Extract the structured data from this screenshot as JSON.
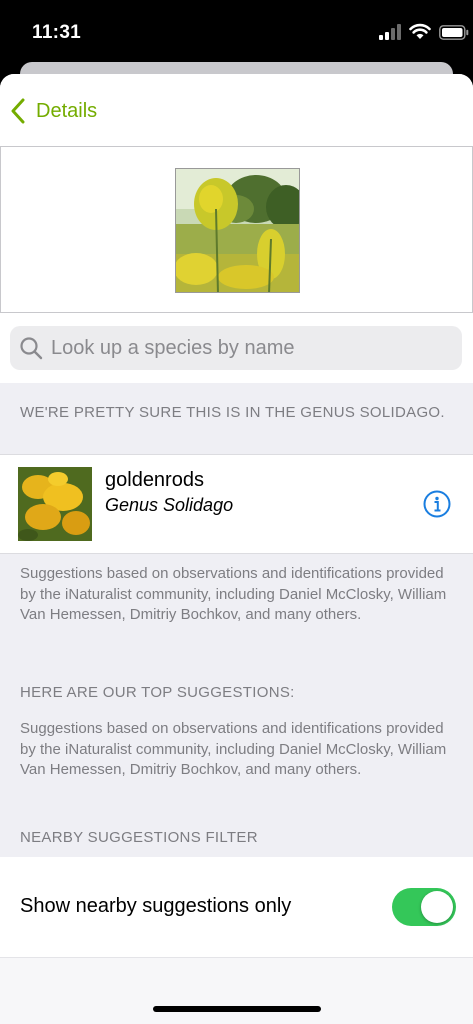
{
  "status_bar": {
    "time": "11:31"
  },
  "nav": {
    "back_label": "Details"
  },
  "search": {
    "placeholder": "Look up a species by name"
  },
  "sections": {
    "top_guess_header": "WE'RE PRETTY SURE THIS IS IN THE GENUS SOLIDAGO.",
    "top_guess": {
      "common_name": "goldenrods",
      "scientific_name": "Genus Solidago"
    },
    "attribution_1": "Suggestions based on observations and identifications provided by the iNaturalist community, including Daniel McClosky, William Van Hemessen, Dmitriy Bochkov, and many others.",
    "top_suggestions_header": "HERE ARE OUR TOP SUGGESTIONS:",
    "attribution_2": "Suggestions based on observations and identifications provided by the iNaturalist community, including Daniel McClosky, William Van Hemessen, Dmitriy Bochkov, and many others.",
    "nearby_filter_header": "NEARBY SUGGESTIONS FILTER",
    "nearby_toggle_label": "Show nearby suggestions only",
    "nearby_toggle_on": true
  },
  "colors": {
    "accent": "#74ac00",
    "toggle_on": "#34c759",
    "info": "#1a7ee0"
  },
  "icons": [
    "signal-icon",
    "wifi-icon",
    "battery-icon",
    "back-chevron-icon",
    "search-icon",
    "info-icon"
  ]
}
